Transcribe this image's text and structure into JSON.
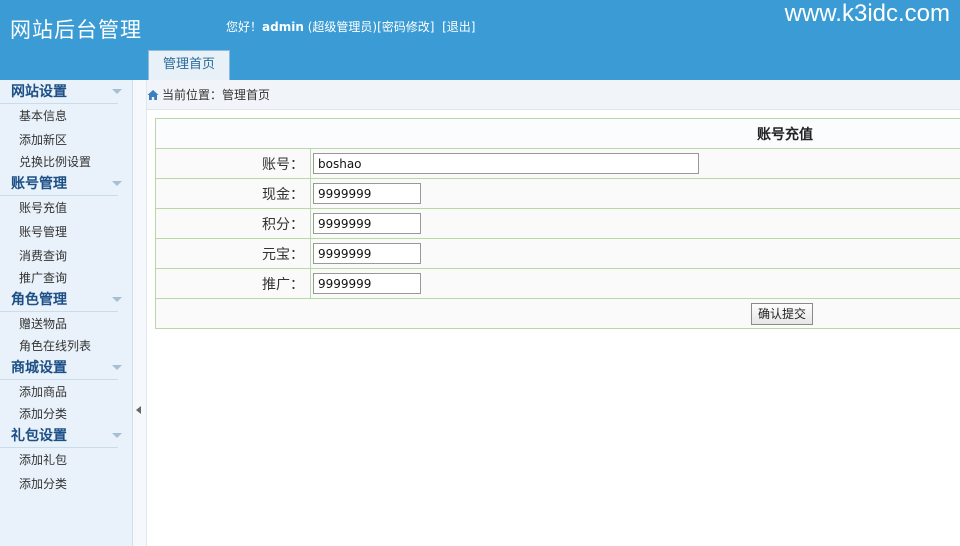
{
  "header": {
    "logo": "网站后台管理",
    "greeting_prefix": "您好！",
    "username": "admin",
    "role": "(超级管理员)",
    "change_password": "[密码修改]",
    "logout": "[退出]",
    "watermark": "www.k3idc.com",
    "tab_home": "管理首页"
  },
  "sidebar": {
    "groups": [
      {
        "title": "网站设置",
        "items": [
          "基本信息",
          "添加新区",
          "兑换比例设置"
        ]
      },
      {
        "title": "账号管理",
        "items": [
          "账号充值",
          "账号管理",
          "消费查询",
          "推广查询"
        ]
      },
      {
        "title": "角色管理",
        "items": [
          "赠送物品",
          "角色在线列表"
        ]
      },
      {
        "title": "商城设置",
        "items": [
          "添加商品",
          "添加分类"
        ]
      },
      {
        "title": "礼包设置",
        "items": [
          "添加礼包",
          "添加分类"
        ]
      }
    ]
  },
  "breadcrumb": {
    "text": "当前位置：管理首页"
  },
  "form": {
    "title": "账号充值",
    "account_label": "账号：",
    "account_value": "boshao",
    "cash_label": "现金：",
    "cash_value": "9999999",
    "points_label": "积分：",
    "points_value": "9999999",
    "ingot_label": "元宝：",
    "ingot_value": "9999999",
    "promo_label": "推广：",
    "promo_value": "9999999",
    "submit_label": "确认提交"
  },
  "colors": {
    "header_bg": "#3a9bd5",
    "sidebar_bg": "#e9f2fa",
    "group_title": "#1c4f86",
    "table_border": "#b7d9a7"
  }
}
